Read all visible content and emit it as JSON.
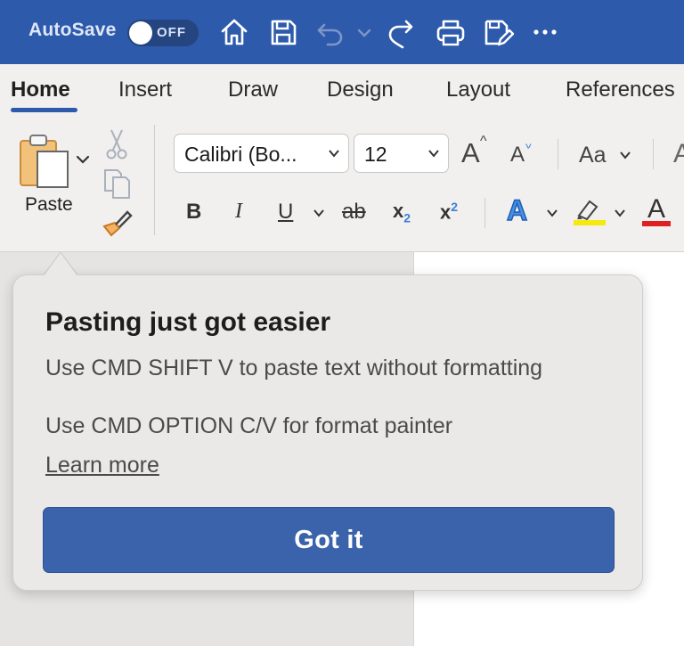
{
  "titlebar": {
    "autosave_label": "AutoSave",
    "autosave_state": "OFF",
    "bg_color": "#2e5aac",
    "icons": [
      "home-icon",
      "save-icon",
      "undo-icon",
      "undo-dropdown-icon",
      "redo-icon",
      "print-icon",
      "save-as-icon",
      "more-icon"
    ]
  },
  "tabs": [
    {
      "label": "Home",
      "active": true
    },
    {
      "label": "Insert"
    },
    {
      "label": "Draw"
    },
    {
      "label": "Design"
    },
    {
      "label": "Layout"
    },
    {
      "label": "References"
    }
  ],
  "ribbon": {
    "paste_label": "Paste",
    "font_name": "Calibri (Bo...",
    "font_size": "12",
    "case_button": "Aa",
    "bold": "B",
    "italic": "I",
    "underline": "U",
    "strikethrough": "ab",
    "subscript": "x",
    "subscript_mark": "2",
    "superscript": "x",
    "superscript_mark": "2",
    "grow_font": "A",
    "shrink_font": "A",
    "text_effects": "A",
    "font_color": "A",
    "highlight_color": "#f5e90d",
    "font_color_bar": "#e02020"
  },
  "popover": {
    "title": "Pasting just got easier",
    "line1": "Use CMD SHIFT V to paste text without formatting",
    "line2": "Use CMD OPTION C/V for format painter",
    "link": "Learn more",
    "button": "Got it"
  }
}
